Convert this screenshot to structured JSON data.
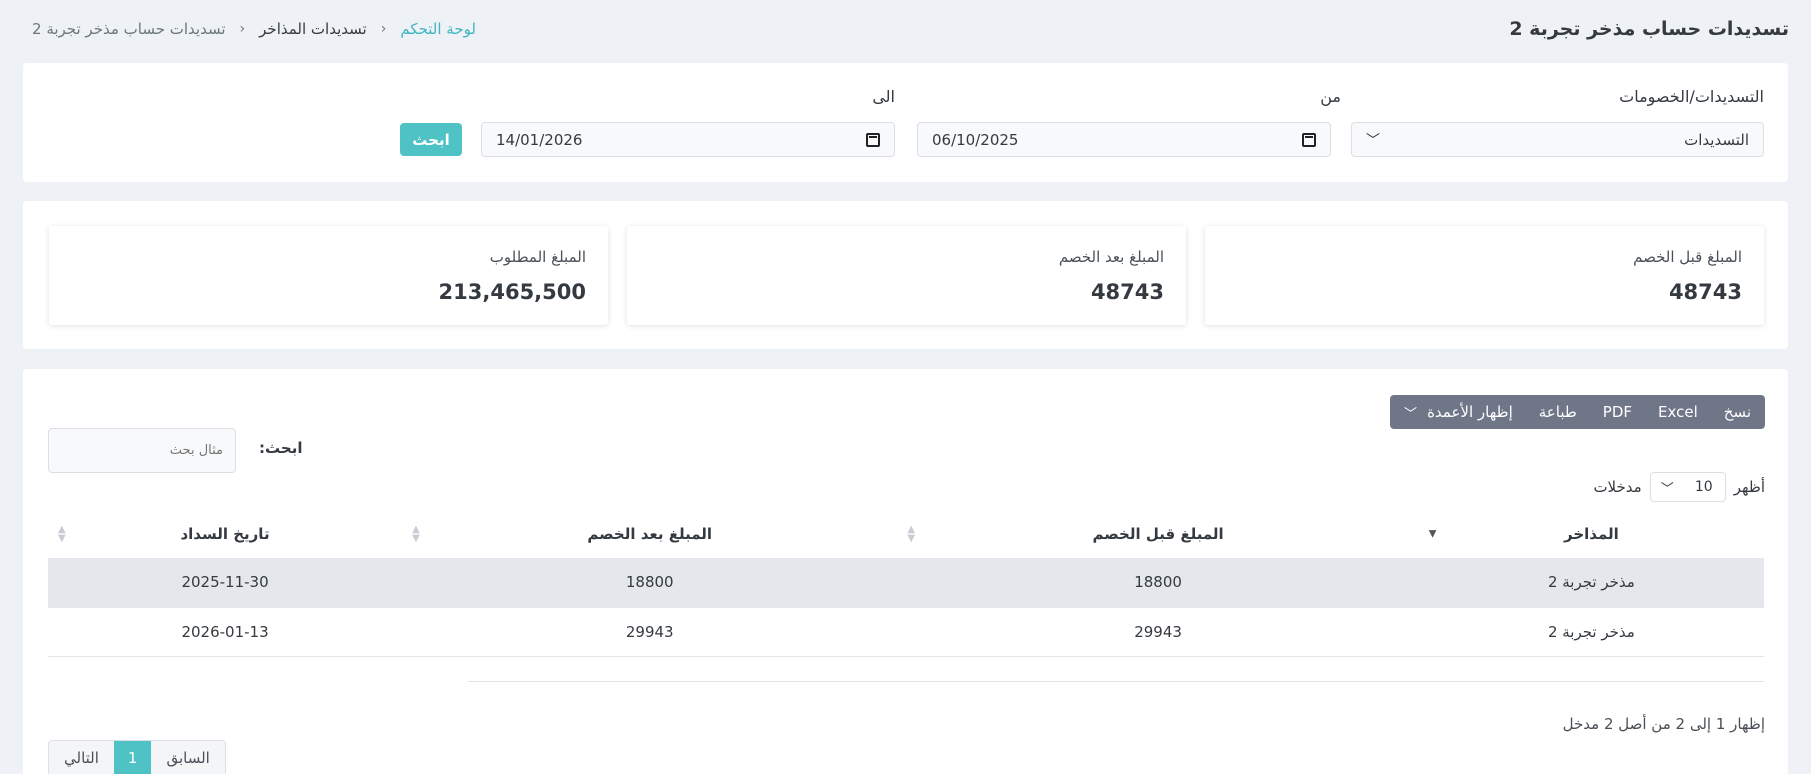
{
  "header": {
    "title": "تسديدات حساب مذخر تجربة 2",
    "breadcrumb": {
      "home": "لوحة التحكم",
      "section": "تسديدات المذاخر",
      "current": "تسديدات حساب مذخر تجربة 2"
    }
  },
  "filters": {
    "type_label": "التسديدات/الخصومات",
    "type_value": "التسديدات",
    "from_label": "من",
    "from_value": "06/10/2025",
    "to_label": "الى",
    "to_value": "14/01/2026",
    "search_button": "ابحث"
  },
  "stats": [
    {
      "label": "المبلغ قبل الخصم",
      "value": "48743"
    },
    {
      "label": "المبلغ بعد الخصم",
      "value": "48743"
    },
    {
      "label": "المبلغ المطلوب",
      "value": "213,465,500"
    }
  ],
  "toolbar": {
    "copy": "نسخ",
    "excel": "Excel",
    "pdf": "PDF",
    "print": "طباعة",
    "columns": "إظهار الأعمدة"
  },
  "table_search": {
    "label": "ابحث:",
    "placeholder": "مثال بحث"
  },
  "length": {
    "show": "أظهر",
    "value": "10",
    "entries": "مدخلات"
  },
  "table": {
    "headers": [
      "المذاخر",
      "المبلغ قبل الخصم",
      "المبلغ بعد الخصم",
      "تاريخ السداد"
    ],
    "rows": [
      [
        "مذخر تجربة 2",
        "18800",
        "18800",
        "2025-11-30"
      ],
      [
        "مذخر تجربة 2",
        "29943",
        "29943",
        "2026-01-13"
      ]
    ]
  },
  "info": "إظهار 1 إلى 2 من أصل 2 مدخل",
  "pagination": {
    "previous": "السابق",
    "page": "1",
    "next": "التالي"
  }
}
